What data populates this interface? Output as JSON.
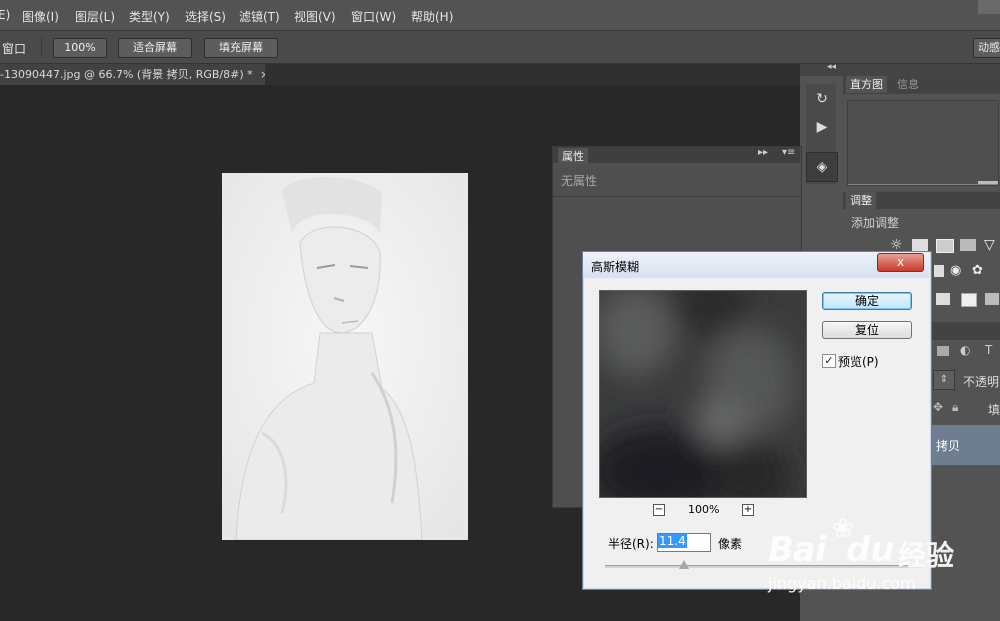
{
  "menubar": {
    "items": [
      {
        "label": "E)"
      },
      {
        "label": "图像(I)"
      },
      {
        "label": "图层(L)"
      },
      {
        "label": "类型(Y)"
      },
      {
        "label": "选择(S)"
      },
      {
        "label": "滤镜(T)"
      },
      {
        "label": "视图(V)"
      },
      {
        "label": "窗口(W)"
      },
      {
        "label": "帮助(H)"
      }
    ]
  },
  "options_bar": {
    "window_label": "窗口",
    "zoom_100_label": "100%",
    "fit_screen_label": "适合屏幕",
    "fill_screen_label": "填充屏幕",
    "right_label": "动感"
  },
  "document": {
    "tab_title": "-13090447.jpg @ 66.7% (背景 拷贝, RGB/8#) *",
    "tab_close": "×"
  },
  "panels": {
    "histogram_tab": "直方图",
    "info_tab": "信息",
    "adjustments_tab": "调整",
    "add_adjustment": "添加调整",
    "properties_title": "属性",
    "no_properties": "无属性",
    "layers_opacity_label": "不透明",
    "layers_fill_label": "填",
    "layer_name": "拷贝"
  },
  "dialog": {
    "title": "高斯模糊",
    "close_symbol": "x",
    "ok_label": "确定",
    "reset_label": "复位",
    "preview_label": "预览(P)",
    "preview_checked": true,
    "zoom_out_symbol": "−",
    "zoom_in_symbol": "+",
    "zoom_level": "100%",
    "radius_label": "半径(R):",
    "radius_value": "11.4",
    "radius_unit": "像素"
  },
  "watermark": {
    "brand_text": "Bai",
    "brand_text_2": "du",
    "brand_cn": "经验",
    "url": "jingyan.baidu.com"
  },
  "colors": {
    "ui_dark": "#535353",
    "canvas_bg": "#282828",
    "dialog_bg": "#f0f0f0",
    "selection_blue": "#3399ff"
  }
}
